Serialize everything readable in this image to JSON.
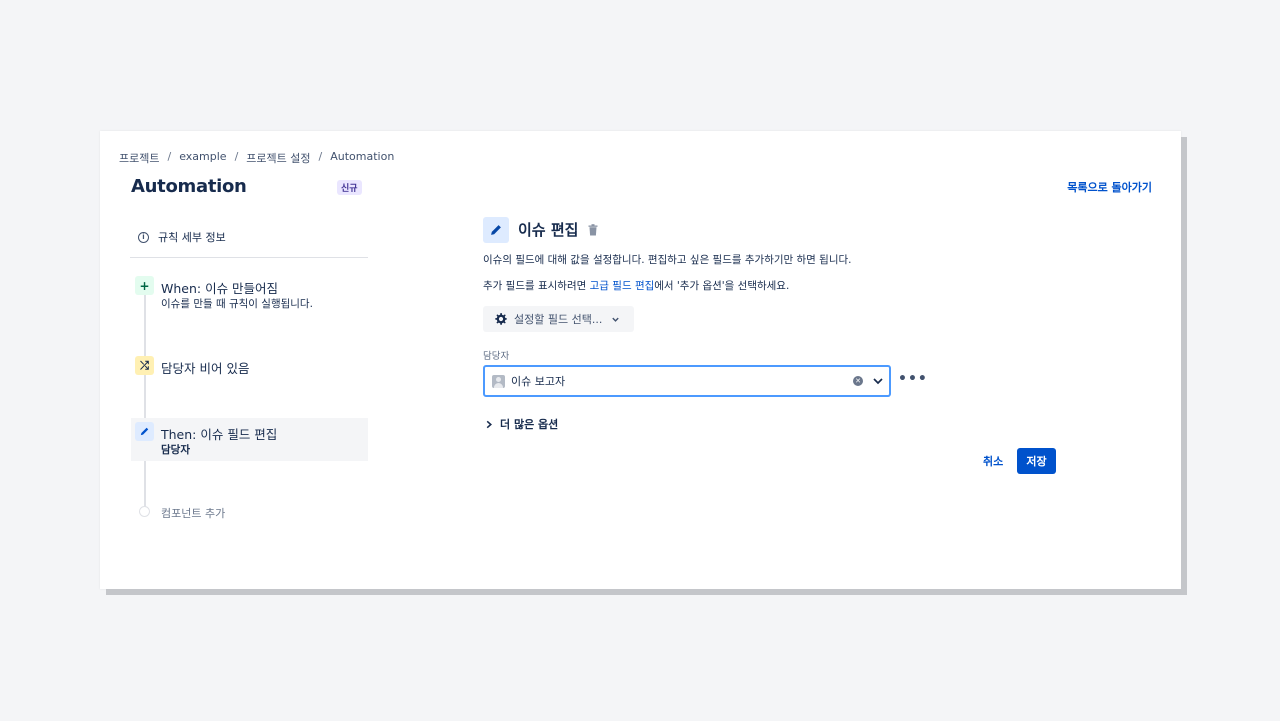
{
  "breadcrumb": [
    "프로젝트",
    "example",
    "프로젝트 설정",
    "Automation"
  ],
  "breadcrumb_sep": "/",
  "page_title": "Automation",
  "new_badge": "신규",
  "back_link": "목록으로 돌아가기",
  "rule_details": "규칙 세부 정보",
  "steps": {
    "trigger": {
      "title": "When: 이슈 만들어짐",
      "subtitle": "이슈를 만들 때 규칙이 실행됩니다.",
      "icon": "plus-icon"
    },
    "condition": {
      "title": "담당자 비어 있음",
      "icon": "shuffle-icon"
    },
    "action": {
      "title": "Then: 이슈 필드 편집",
      "subtitle": "담당자",
      "icon": "pencil-icon"
    }
  },
  "add_component": "컴포넌트 추가",
  "action_panel": {
    "title": "이슈 편집",
    "description": "이슈의 필드에 대해 값을 설정합니다. 편집하고 싶은 필드를 추가하기만 하면 됩니다.",
    "hint_prefix": "추가 필드를 표시하려면 ",
    "hint_link": "고급 필드 편집",
    "hint_suffix": "에서 '추가 옵션'을 선택하세요.",
    "field_select_button": "설정할 필드 선택...",
    "assignee_label": "담당자",
    "assignee_value": "이슈 보고자",
    "more_options": "더 많은 옵션",
    "cancel": "취소",
    "save": "저장"
  },
  "colors": {
    "primary": "#0052cc",
    "focus_border": "#4c9aff"
  }
}
